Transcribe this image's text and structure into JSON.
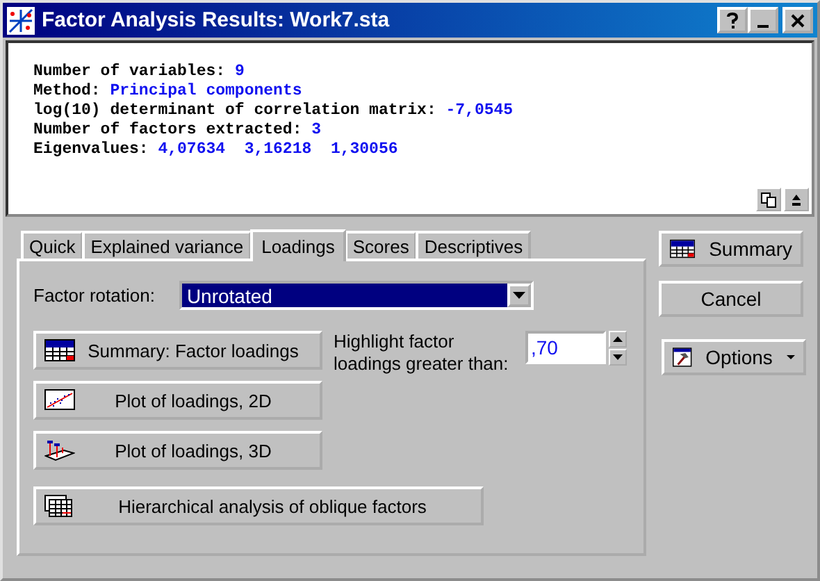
{
  "window": {
    "title": "Factor Analysis Results: Work7.sta"
  },
  "results": [
    {
      "label": "Number of variables: ",
      "value": "9"
    },
    {
      "label": "Method: ",
      "value": "Principal components"
    },
    {
      "label": "log(10) determinant of correlation matrix: ",
      "value": "-7,0545"
    },
    {
      "label": "Number of factors extracted: ",
      "value": "3"
    },
    {
      "label": "Eigenvalues: ",
      "value": "4,07634  3,16218  1,30056"
    }
  ],
  "tabs": [
    {
      "label": "Quick",
      "selected": false
    },
    {
      "label": "Explained variance",
      "selected": false
    },
    {
      "label": "Loadings",
      "selected": true
    },
    {
      "label": "Scores",
      "selected": false
    },
    {
      "label": "Descriptives",
      "selected": false
    }
  ],
  "factor_rotation": {
    "label": "Factor rotation:",
    "value": "Unrotated"
  },
  "buttons": [
    {
      "label": "Summary: Factor loadings",
      "kind": "table"
    },
    {
      "label": "Plot of loadings, 2D",
      "kind": "plot2d"
    },
    {
      "label": "Plot of loadings, 3D",
      "kind": "plot3d"
    }
  ],
  "highlight": {
    "label": "Highlight factor loadings greater than:",
    "value": ",70"
  },
  "hierarchical_button": {
    "label": "Hierarchical analysis of oblique factors"
  },
  "side_buttons": [
    {
      "label": "Summary",
      "kind": "table"
    },
    {
      "label": "Cancel",
      "kind": "plain"
    },
    {
      "label": "Options",
      "kind": "menu"
    }
  ]
}
